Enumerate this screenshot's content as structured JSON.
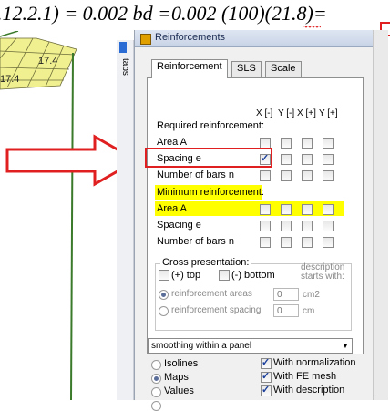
{
  "formula": ".12.2.1) = 0.002 bd =0.002 (100)(21.8)=",
  "model": {
    "mesh_values": [
      "17.4",
      "17.4"
    ]
  },
  "side_tab": {
    "label": "tabs"
  },
  "panel": {
    "title": "Reinforcements",
    "tabs": [
      {
        "label": "Reinforcement"
      },
      {
        "label": "SLS"
      },
      {
        "label": "Scale"
      }
    ],
    "columns": [
      "X [-]",
      "Y [-]",
      "X [+]",
      "Y [+]"
    ],
    "required_heading": "Required reinforcement:",
    "required_rows": [
      {
        "label": "Area A",
        "checks": [
          false,
          false,
          false,
          false
        ]
      },
      {
        "label": "Spacing e",
        "checks": [
          true,
          false,
          false,
          false
        ]
      },
      {
        "label": "Number of bars n",
        "checks": [
          false,
          false,
          false,
          false
        ]
      }
    ],
    "minimum_heading": "Minimum reinforcement:",
    "minimum_rows": [
      {
        "label": "Area A",
        "checks": [
          false,
          false,
          false,
          false
        ]
      },
      {
        "label": "Spacing e",
        "checks": [
          false,
          false,
          false,
          false
        ]
      },
      {
        "label": "Number of bars n",
        "checks": [
          false,
          false,
          false,
          false
        ]
      }
    ],
    "cross": {
      "title": "Cross presentation:",
      "top_label": "(+) top",
      "bottom_label": "(-) bottom",
      "desc_line1": "description",
      "desc_line2": "starts with:",
      "areas_label": "reinforcement areas",
      "spacing_label": "reinforcement spacing",
      "areas_value": "0",
      "areas_unit": "cm2",
      "spacing_value": "0",
      "spacing_unit": "cm"
    },
    "smoothing_select": "smoothing within a panel",
    "display_options": {
      "left": [
        {
          "label": "Isolines",
          "selected": false
        },
        {
          "label": "Maps",
          "selected": true
        },
        {
          "label": "Values",
          "selected": false
        }
      ],
      "right": [
        {
          "label": "With normalization",
          "checked": true
        },
        {
          "label": "With FE mesh",
          "checked": true
        },
        {
          "label": "With description",
          "checked": true
        }
      ]
    }
  },
  "colors": {
    "highlight": "#ffff00",
    "annotation_red": "#e02020"
  }
}
